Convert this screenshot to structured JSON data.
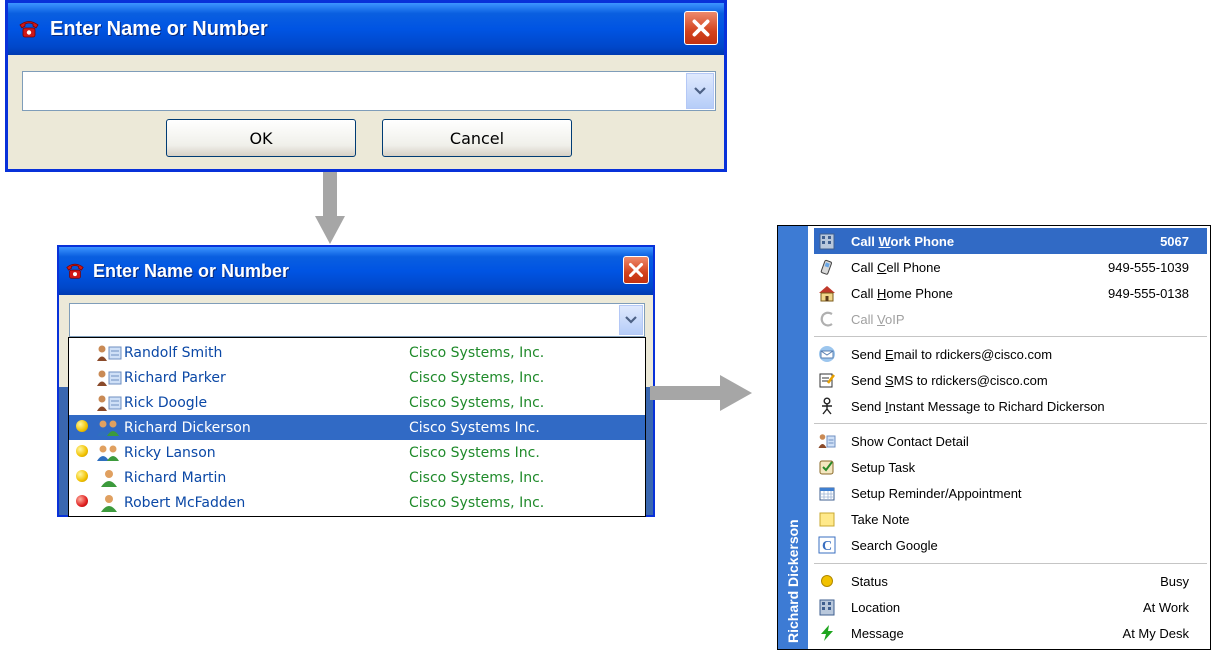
{
  "dialog": {
    "title": "Enter Name or Number",
    "input_value": "",
    "ok_label": "OK",
    "cancel_label": "Cancel"
  },
  "dialog2": {
    "title": "Enter Name or Number",
    "input_value": ""
  },
  "suggestions": [
    {
      "name": "Randolf Smith",
      "company": "Cisco Systems, Inc.",
      "presence": "none",
      "icon": "contact-card-icon"
    },
    {
      "name": "Richard Parker",
      "company": "Cisco Systems, Inc.",
      "presence": "none",
      "icon": "contact-card-icon"
    },
    {
      "name": "Rick Doogle",
      "company": "Cisco Systems, Inc.",
      "presence": "none",
      "icon": "contact-card-icon"
    },
    {
      "name": "Richard Dickerson",
      "company": "Cisco Systems Inc.",
      "presence": "busy",
      "icon": "group-contact-icon",
      "selected": true
    },
    {
      "name": "Ricky Lanson",
      "company": "Cisco Systems Inc.",
      "presence": "busy",
      "icon": "group-contact-icon"
    },
    {
      "name": "Richard Martin",
      "company": "Cisco Systems, Inc.",
      "presence": "busy",
      "icon": "person-icon"
    },
    {
      "name": "Robert McFadden",
      "company": "Cisco Systems, Inc.",
      "presence": "offline",
      "icon": "person-icon"
    }
  ],
  "menu": {
    "contact_name": "Richard Dickerson",
    "call_items": [
      {
        "pre": "Call ",
        "key": "W",
        "post": "ork Phone",
        "value": "5067",
        "icon": "office-building-icon"
      },
      {
        "pre": "Call ",
        "key": "C",
        "post": "ell Phone",
        "value": "949-555-1039",
        "icon": "cell-phone-icon"
      },
      {
        "pre": "Call ",
        "key": "H",
        "post": "ome Phone",
        "value": "949-555-0138",
        "icon": "home-icon"
      },
      {
        "pre": "Call ",
        "key": "V",
        "post": "oIP",
        "value": "",
        "icon": "voip-icon"
      }
    ],
    "send_items": [
      {
        "pre": "Send ",
        "key": "E",
        "post": "mail to rdickers@cisco.com",
        "icon": "email-icon"
      },
      {
        "pre": "Send ",
        "key": "S",
        "post": "MS to rdickers@cisco.com",
        "icon": "sms-icon"
      },
      {
        "pre": "Send ",
        "key": "I",
        "post": "nstant Message to Richard Dickerson",
        "icon": "instant-message-icon"
      }
    ],
    "tool_items": [
      {
        "label": "Show Contact Detail",
        "icon": "contact-card-icon"
      },
      {
        "label": "Setup Task",
        "icon": "task-icon"
      },
      {
        "label": "Setup Reminder/Appointment",
        "icon": "calendar-icon"
      },
      {
        "label": "Take Note",
        "icon": "note-icon"
      },
      {
        "label": "Search Google",
        "icon": "google-icon"
      }
    ],
    "status_items": [
      {
        "label": "Status",
        "value": "Busy",
        "icon": "status-dot-icon"
      },
      {
        "label": "Location",
        "value": "At Work",
        "icon": "office-building-icon"
      },
      {
        "label": "Message",
        "value": "At My Desk",
        "icon": "lightning-icon"
      }
    ]
  },
  "colors": {
    "selection": "#316ac5",
    "busy": "#f2c200",
    "offline": "#e02020",
    "company_text": "#1f8a2a",
    "name_text": "#0b48a6"
  }
}
